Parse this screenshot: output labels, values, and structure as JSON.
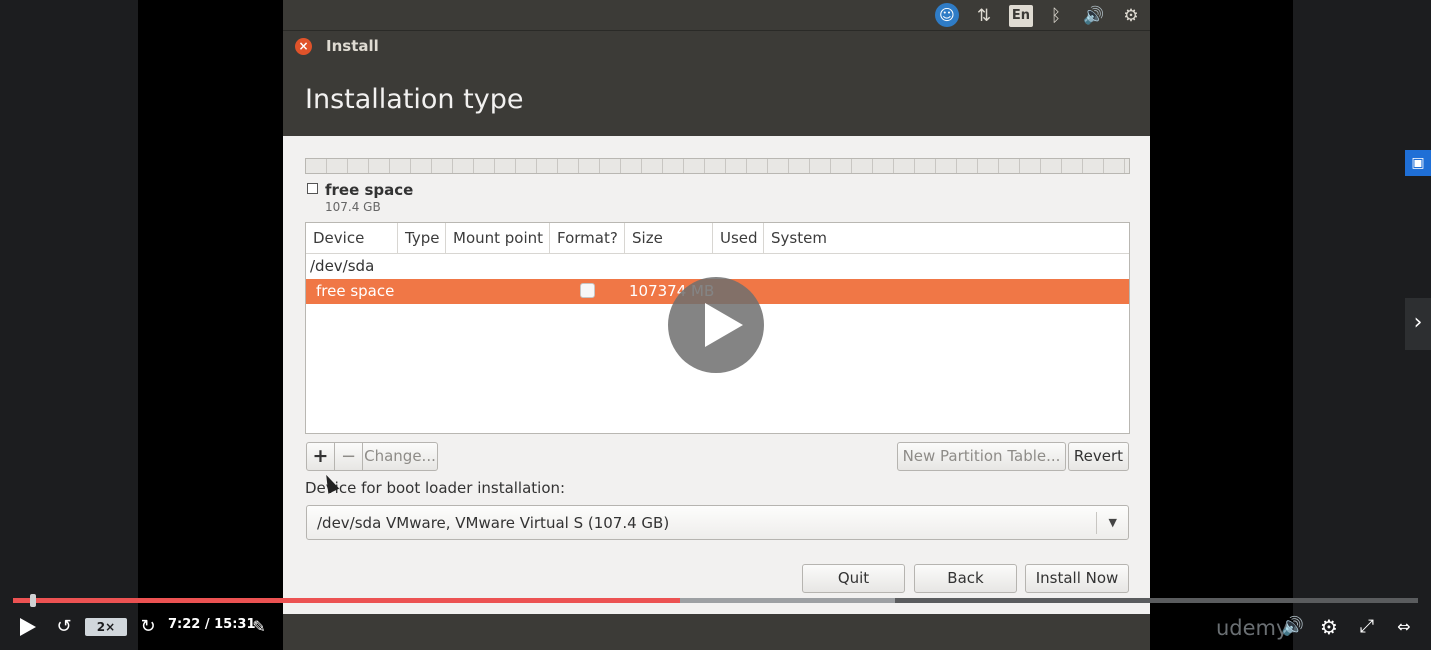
{
  "tray": {
    "lang": "En"
  },
  "window": {
    "title": "Install",
    "page_title": "Installation type"
  },
  "partition": {
    "legend_label": "free space",
    "legend_size": "107.4 GB"
  },
  "table": {
    "columns": [
      "Device",
      "Type",
      "Mount point",
      "Format?",
      "Size",
      "Used",
      "System"
    ],
    "rows": [
      {
        "device": "/dev/sda"
      },
      {
        "device": "free space",
        "format_checked": false,
        "size": "107374 MB",
        "selected": true
      }
    ]
  },
  "actions": {
    "add": "+",
    "remove": "−",
    "change": "Change...",
    "new_partition_table": "New Partition Table...",
    "revert": "Revert"
  },
  "boot_loader": {
    "label": "Device for boot loader installation:",
    "value": "/dev/sda  VMware, VMware Virtual S (107.4 GB)"
  },
  "footer_buttons": {
    "quit": "Quit",
    "back": "Back",
    "install_now": "Install Now"
  },
  "player": {
    "speed": "2×",
    "time": "7:22 / 15:31",
    "brand": "udemy",
    "progress_fraction": 0.475,
    "accent_color": "#ec5252"
  }
}
